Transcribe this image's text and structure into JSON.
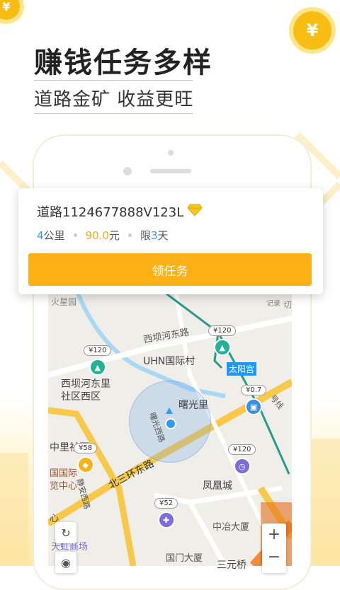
{
  "promo": {
    "headline": "赚钱任务多样",
    "subline": "道路金矿  收益更旺",
    "coin_symbol": "¥"
  },
  "task_card": {
    "title": "道路1124677888V123L",
    "title_icon": "diamond-icon",
    "distance_value": "4",
    "distance_unit": "公里",
    "reward_value": "90.0",
    "reward_unit": "元",
    "limit_prefix": "限",
    "limit_value": "3",
    "limit_unit": "天",
    "claim_label": "领任务"
  },
  "map": {
    "labels": {
      "huoxingyuan": "火星园",
      "xibahedonglu": "西坝河东路",
      "uhn": "UHN国际村",
      "taiyanggong": "太阳宫",
      "xibahedongli": "西坝河东里",
      "shequxiqu": "社区西区",
      "shuguangli": "曙光里",
      "shuguangxilu": "曙光西路",
      "zhongli": "中里社区",
      "guoji": "国国际",
      "lanzhongxin": "览中心",
      "beisanhuan": "北三环东路",
      "fenghuangcheng": "凤凰城",
      "zhongye": "中冶大厦",
      "guomen": "国门大厦",
      "sanyuanqiao": "三元桥",
      "jingmi": "静安西路",
      "tianshangchang": "天虹商场",
      "xin": "心",
      "jilu": "记录",
      "xian": "号线",
      "qiao": "切"
    },
    "pins": [
      {
        "price": "¥120",
        "kind": "road",
        "color": "#21b393"
      },
      {
        "price": "¥120",
        "kind": "road",
        "color": "#21b393"
      },
      {
        "price": "¥0.7",
        "kind": "shop",
        "color": "#3b8fe0"
      },
      {
        "price": "¥58",
        "kind": "diamond",
        "color": "#f3b316"
      },
      {
        "price": "¥120",
        "kind": "clock",
        "color": "#7c6dd8"
      },
      {
        "price": "¥52",
        "kind": "pin",
        "color": "#7c6dd8"
      }
    ],
    "zoom_in": "+",
    "zoom_out": "−"
  },
  "colors": {
    "accent": "#fbb116",
    "blue": "#2e9cf0",
    "orange": "#f5a623"
  }
}
